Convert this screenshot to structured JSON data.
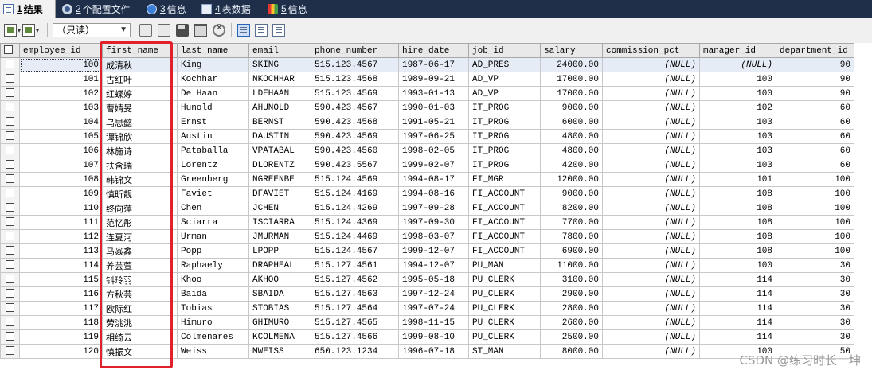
{
  "tabs": [
    {
      "number": "1",
      "label": " 结果",
      "icon": "result-grid-icon",
      "active": true
    },
    {
      "number": "2",
      "label": " 个配置文件",
      "icon": "profile-gear-icon",
      "active": false
    },
    {
      "number": "3",
      "label": " 信息",
      "icon": "info-icon",
      "active": false
    },
    {
      "number": "4",
      "label": " 表数据",
      "icon": "table-data-icon",
      "active": false
    },
    {
      "number": "5",
      "label": " 信息",
      "icon": "info-colors-icon",
      "active": false
    }
  ],
  "toolbar": {
    "mode_select": "（只读）"
  },
  "grid": {
    "columns": [
      "employee_id",
      "first_name",
      "last_name",
      "email",
      "phone_number",
      "hire_date",
      "job_id",
      "salary",
      "commission_pct",
      "manager_id",
      "department_id"
    ],
    "rows": [
      [
        "100",
        "成清秋",
        "King",
        "SKING",
        "515.123.4567",
        "1987-06-17",
        "AD_PRES",
        "24000.00",
        "(NULL)",
        "(NULL)",
        "90"
      ],
      [
        "101",
        "古红叶",
        "Kochhar",
        "NKOCHHAR",
        "515.123.4568",
        "1989-09-21",
        "AD_VP",
        "17000.00",
        "(NULL)",
        "100",
        "90"
      ],
      [
        "102",
        "红蝶婷",
        "De Haan",
        "LDEHAAN",
        "515.123.4569",
        "1993-01-13",
        "AD_VP",
        "17000.00",
        "(NULL)",
        "100",
        "90"
      ],
      [
        "103",
        "曹婧旻",
        "Hunold",
        "AHUNOLD",
        "590.423.4567",
        "1990-01-03",
        "IT_PROG",
        "9000.00",
        "(NULL)",
        "102",
        "60"
      ],
      [
        "104",
        "乌思懿",
        "Ernst",
        "BERNST",
        "590.423.4568",
        "1991-05-21",
        "IT_PROG",
        "6000.00",
        "(NULL)",
        "103",
        "60"
      ],
      [
        "105",
        "谭锦欣",
        "Austin",
        "DAUSTIN",
        "590.423.4569",
        "1997-06-25",
        "IT_PROG",
        "4800.00",
        "(NULL)",
        "103",
        "60"
      ],
      [
        "106",
        "林施诗",
        "Pataballa",
        "VPATABAL",
        "590.423.4560",
        "1998-02-05",
        "IT_PROG",
        "4800.00",
        "(NULL)",
        "103",
        "60"
      ],
      [
        "107",
        "扶含瑞",
        "Lorentz",
        "DLORENTZ",
        "590.423.5567",
        "1999-02-07",
        "IT_PROG",
        "4200.00",
        "(NULL)",
        "103",
        "60"
      ],
      [
        "108",
        "韩锦文",
        "Greenberg",
        "NGREENBE",
        "515.124.4569",
        "1994-08-17",
        "FI_MGR",
        "12000.00",
        "(NULL)",
        "101",
        "100"
      ],
      [
        "109",
        "慎昕靓",
        "Faviet",
        "DFAVIET",
        "515.124.4169",
        "1994-08-16",
        "FI_ACCOUNT",
        "9000.00",
        "(NULL)",
        "108",
        "100"
      ],
      [
        "110",
        "终向萍",
        "Chen",
        "JCHEN",
        "515.124.4269",
        "1997-09-28",
        "FI_ACCOUNT",
        "8200.00",
        "(NULL)",
        "108",
        "100"
      ],
      [
        "111",
        "范忆彤",
        "Sciarra",
        "ISCIARRA",
        "515.124.4369",
        "1997-09-30",
        "FI_ACCOUNT",
        "7700.00",
        "(NULL)",
        "108",
        "100"
      ],
      [
        "112",
        "连夏河",
        "Urman",
        "JMURMAN",
        "515.124.4469",
        "1998-03-07",
        "FI_ACCOUNT",
        "7800.00",
        "(NULL)",
        "108",
        "100"
      ],
      [
        "113",
        "马焱鑫",
        "Popp",
        "LPOPP",
        "515.124.4567",
        "1999-12-07",
        "FI_ACCOUNT",
        "6900.00",
        "(NULL)",
        "108",
        "100"
      ],
      [
        "114",
        "养芸萱",
        "Raphaely",
        "DRAPHEAL",
        "515.127.4561",
        "1994-12-07",
        "PU_MAN",
        "11000.00",
        "(NULL)",
        "100",
        "30"
      ],
      [
        "115",
        "钭玲羽",
        "Khoo",
        "AKHOO",
        "515.127.4562",
        "1995-05-18",
        "PU_CLERK",
        "3100.00",
        "(NULL)",
        "114",
        "30"
      ],
      [
        "116",
        "方秋芸",
        "Baida",
        "SBAIDA",
        "515.127.4563",
        "1997-12-24",
        "PU_CLERK",
        "2900.00",
        "(NULL)",
        "114",
        "30"
      ],
      [
        "117",
        "欧际红",
        "Tobias",
        "STOBIAS",
        "515.127.4564",
        "1997-07-24",
        "PU_CLERK",
        "2800.00",
        "(NULL)",
        "114",
        "30"
      ],
      [
        "118",
        "劳洮洮",
        "Himuro",
        "GHIMURO",
        "515.127.4565",
        "1998-11-15",
        "PU_CLERK",
        "2600.00",
        "(NULL)",
        "114",
        "30"
      ],
      [
        "119",
        "相绮云",
        "Colmenares",
        "KCOLMENA",
        "515.127.4566",
        "1999-08-10",
        "PU_CLERK",
        "2500.00",
        "(NULL)",
        "114",
        "30"
      ],
      [
        "120",
        "慎振文",
        "Weiss",
        "MWEISS",
        "650.123.1234",
        "1996-07-18",
        "ST_MAN",
        "8000.00",
        "(NULL)",
        "100",
        "50"
      ]
    ]
  },
  "watermark": "CSDN @练习时长一坤"
}
